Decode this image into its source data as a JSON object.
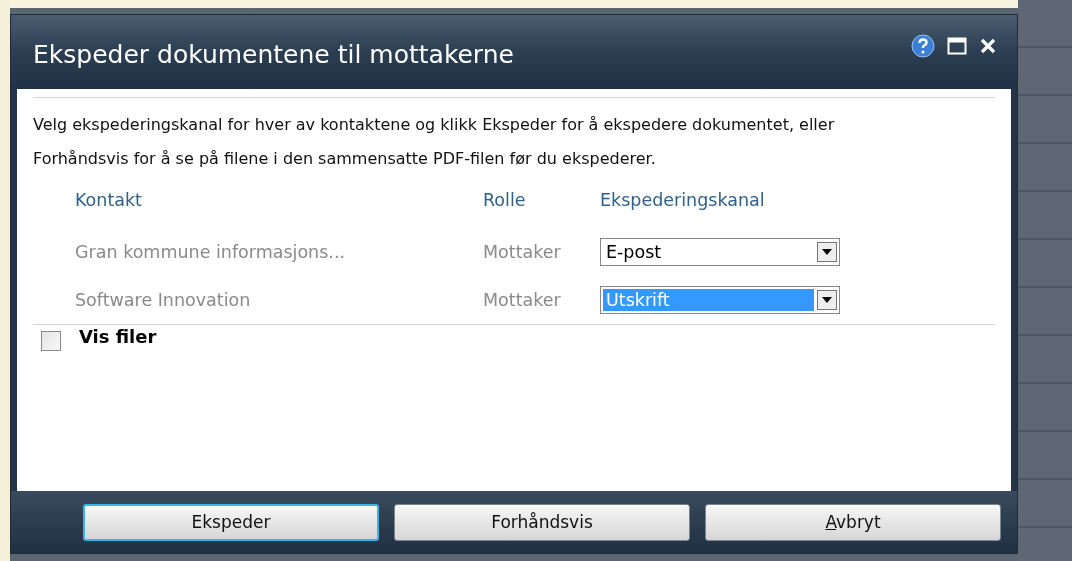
{
  "dialog": {
    "title": "Ekspeder dokumentene til mottakerne",
    "instructions": "Velg ekspederingskanal for hver av kontaktene og klikk Ekspeder for å ekspedere dokumentet, eller Forhåndsvis for å se på filene i den sammensatte PDF-filen før du ekspederer.",
    "columns": [
      "Kontakt",
      "Rolle",
      "Ekspederingskanal"
    ],
    "rows": [
      {
        "contact": "Gran kommune informasjons...",
        "role": "Mottaker",
        "channel": "E-post",
        "highlighted": false
      },
      {
        "contact": "Software Innovation",
        "role": "Mottaker",
        "channel": "Utskrift",
        "highlighted": true
      }
    ],
    "show_files": {
      "label": "Vis filer",
      "checked": false
    },
    "buttons": [
      {
        "label": "Ekspeder",
        "focused": true
      },
      {
        "label": "Forhåndsvis",
        "focused": false
      },
      {
        "label": "Avbryt",
        "focused": false,
        "first_letter_underlined": true
      }
    ]
  }
}
